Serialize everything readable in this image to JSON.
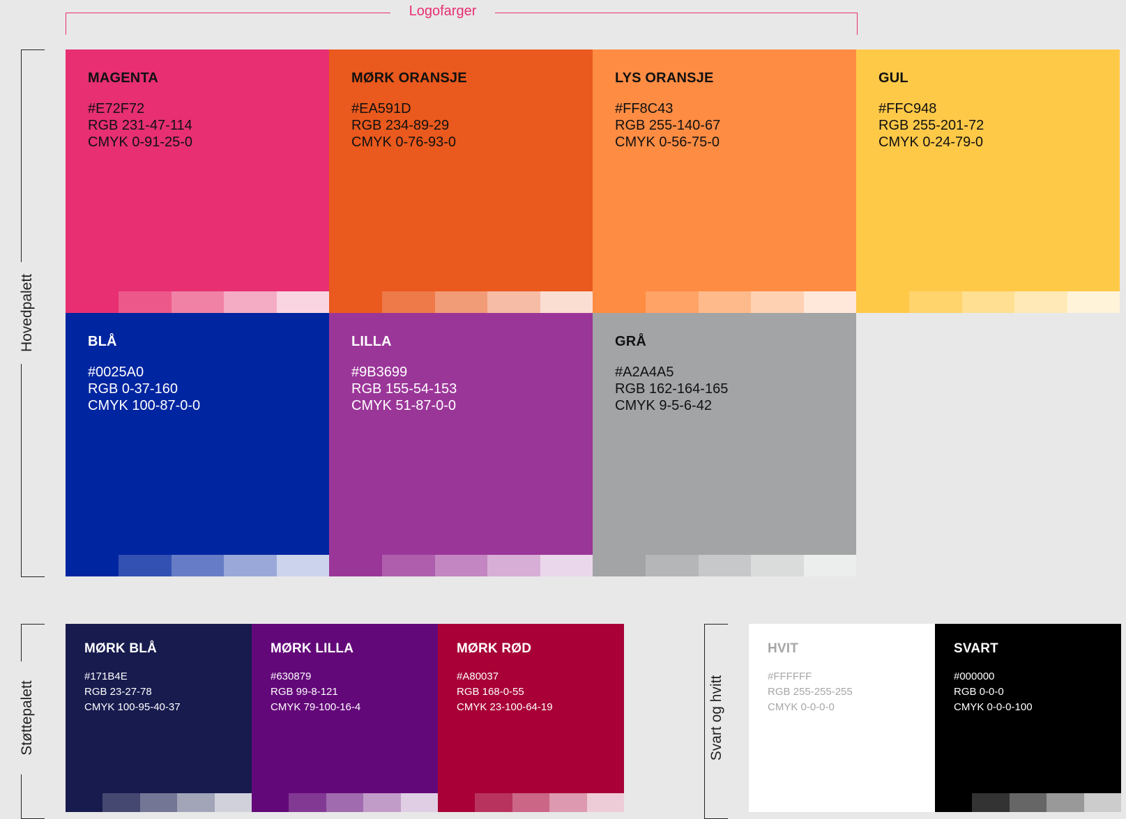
{
  "logo_label": "Logofarger",
  "main_label": "Hovedpalett",
  "support_label": "Støttepalett",
  "bw_label": "Svart og hvitt",
  "main_colors": [
    {
      "name": "MAGENTA",
      "hex": "#E72F72",
      "rgb": "RGB 231-47-114",
      "cmyk": "CMYK 0-91-25-0",
      "color": "#E72F72",
      "text_color": "#111111",
      "tints": [
        "#EC5889",
        "#F082A6",
        "#F4ACC4",
        "#F9D5E1"
      ]
    },
    {
      "name": "MØRK ORANSJE",
      "hex": "#EA591D",
      "rgb": "RGB 234-89-29",
      "cmyk": "CMYK 0-76-93-0",
      "color": "#EA591D",
      "text_color": "#111111",
      "tints": [
        "#EE7A4A",
        "#F29B77",
        "#F6BCA5",
        "#FADED2"
      ]
    },
    {
      "name": "LYS ORANSJE",
      "hex": "#FF8C43",
      "rgb": "RGB 255-140-67",
      "cmyk": "CMYK 0-56-75-0",
      "color": "#FF8C43",
      "text_color": "#111111",
      "tints": [
        "#FFA366",
        "#FFBA8C",
        "#FFD1B3",
        "#FFE8D9"
      ]
    },
    {
      "name": "GUL",
      "hex": "#FFC948",
      "rgb": "RGB 255-201-72",
      "cmyk": "CMYK 0-24-79-0",
      "color": "#FFC948",
      "text_color": "#111111",
      "tints": [
        "#FFD46D",
        "#FFDF91",
        "#FFE9B6",
        "#FFF4DA"
      ]
    },
    {
      "name": "BLÅ",
      "hex": "#0025A0",
      "rgb": "RGB 0-37-160",
      "cmyk": "CMYK 100-87-0-0",
      "color": "#0025A0",
      "text_color": "#ffffff",
      "tints": [
        "#3351B3",
        "#667CC6",
        "#99A8D9",
        "#CCD3EC"
      ]
    },
    {
      "name": "LILLA",
      "hex": "#9B3699",
      "rgb": "RGB 155-54-153",
      "cmyk": "CMYK 51-87-0-0",
      "color": "#9B3699",
      "text_color": "#ffffff",
      "tints": [
        "#AF5EAD",
        "#C386C2",
        "#D7AFD6",
        "#EBD7EB"
      ]
    },
    {
      "name": "GRÅ",
      "hex": "#A2A4A5",
      "rgb": "RGB 162-164-165",
      "cmyk": "CMYK 9-5-6-42",
      "color": "#A2A4A5",
      "text_color": "#111111",
      "tints": [
        "#B5B6B7",
        "#C7C8C9",
        "#DADBDB",
        "#ECEDED"
      ]
    }
  ],
  "support_colors": [
    {
      "name": "MØRK BLÅ",
      "hex": "#171B4E",
      "rgb": "RGB 23-27-78",
      "cmyk": "CMYK 100-95-40-37",
      "color": "#171B4E",
      "text_color": "#ffffff",
      "tints": [
        "#454971",
        "#747695",
        "#A2A4B8",
        "#D1D1DC"
      ]
    },
    {
      "name": "MØRK LILLA",
      "hex": "#630879",
      "rgb": "RGB 99-8-121",
      "cmyk": "CMYK 79-100-16-4",
      "color": "#630879",
      "text_color": "#ffffff",
      "tints": [
        "#823994",
        "#A16BAF",
        "#C19CC9",
        "#E0CEE4"
      ]
    },
    {
      "name": "MØRK RØD",
      "hex": "#A80037",
      "rgb": "RGB 168-0-55",
      "cmyk": "CMYK 23-100-64-19",
      "color": "#A80037",
      "text_color": "#ffffff",
      "tints": [
        "#B9335F",
        "#CB6687",
        "#DC99AF",
        "#EECCD7"
      ]
    }
  ],
  "bw_colors": [
    {
      "name": "HVIT",
      "hex": "#FFFFFF",
      "rgb": "RGB 255-255-255",
      "cmyk": "CMYK 0-0-0-0",
      "color": "#FFFFFF",
      "text_color": "#a6a6a6",
      "tints": []
    },
    {
      "name": "SVART",
      "hex": "#000000",
      "rgb": "RGB 0-0-0",
      "cmyk": "CMYK 0-0-0-100",
      "color": "#000000",
      "text_color": "#ffffff",
      "tints": [
        "#333333",
        "#666666",
        "#999999",
        "#CCCCCC"
      ]
    }
  ]
}
